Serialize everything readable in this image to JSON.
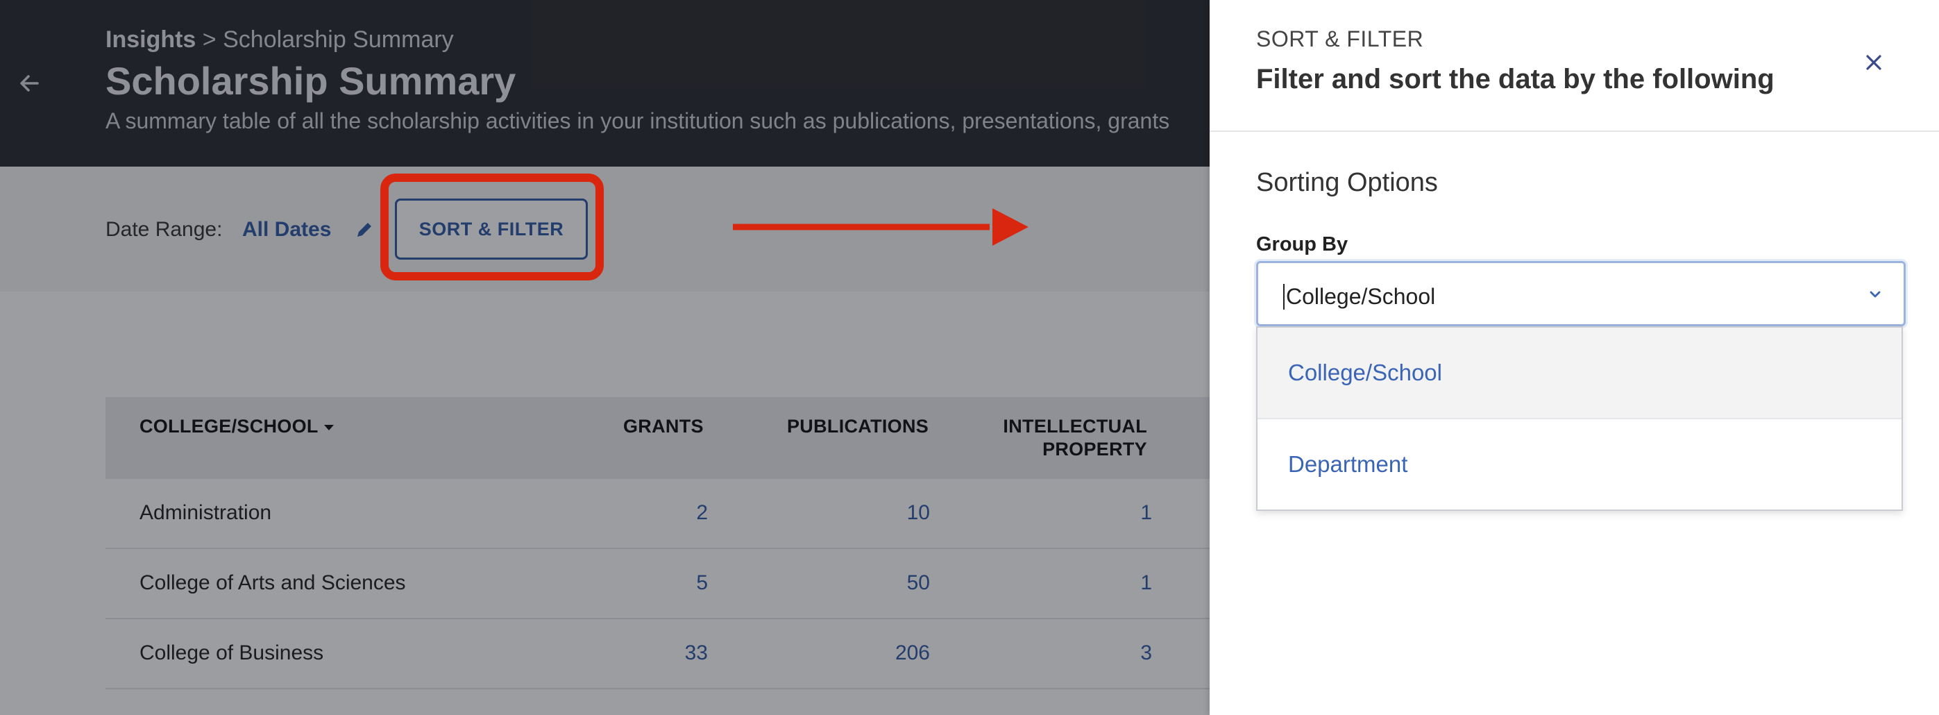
{
  "header": {
    "breadcrumb_root": "Insights",
    "breadcrumb_separator": ">",
    "breadcrumb_current": "Scholarship Summary",
    "title": "Scholarship Summary",
    "description": "A summary table of all the scholarship activities in your institution such as publications, presentations, grants"
  },
  "toolbar": {
    "date_label": "Date Range:",
    "date_value": "All Dates",
    "sort_filter_label": "SORT & FILTER"
  },
  "table": {
    "columns": [
      "COLLEGE/SCHOOL",
      "GRANTS",
      "PUBLICATIONS",
      "INTELLECTUAL PROPERTY"
    ],
    "rows": [
      {
        "name": "Administration",
        "grants": "2",
        "publications": "10",
        "ip": "1"
      },
      {
        "name": "College of Arts and Sciences",
        "grants": "5",
        "publications": "50",
        "ip": "1"
      },
      {
        "name": "College of Business",
        "grants": "33",
        "publications": "206",
        "ip": "3"
      }
    ]
  },
  "drawer": {
    "eyebrow": "SORT & FILTER",
    "title": "Filter and sort the data by the following",
    "section_heading": "Sorting Options",
    "group_by_label": "Group By",
    "group_by_value": "College/School",
    "options": [
      "College/School",
      "Department"
    ]
  },
  "colors": {
    "header_bg": "#2a2c33",
    "accent_blue": "#2f5aa8",
    "highlight_red": "#d9270f"
  },
  "icons": [
    "back-arrow-icon",
    "pencil-icon",
    "sort-caret-icon",
    "close-icon",
    "chevron-down-icon"
  ]
}
